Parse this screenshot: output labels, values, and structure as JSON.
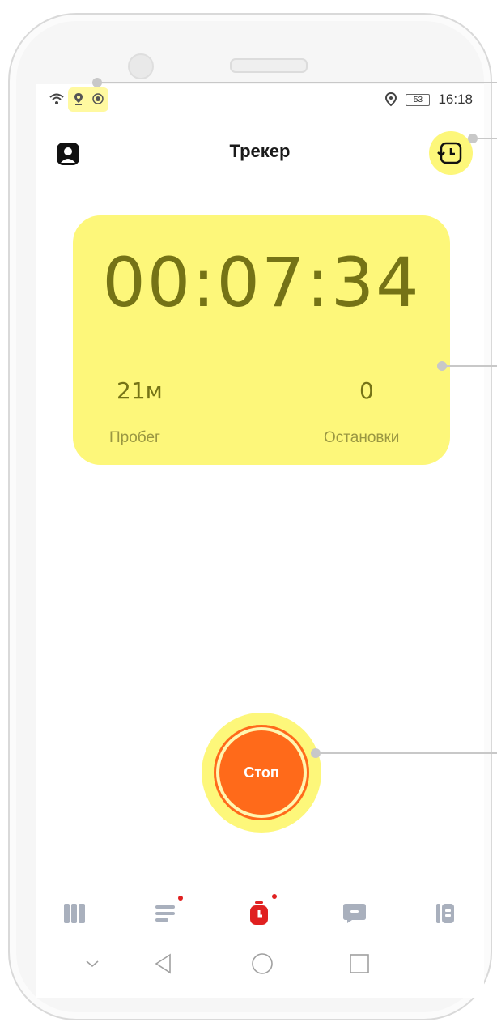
{
  "status_bar": {
    "time": "16:18",
    "battery": "53",
    "icons": [
      "wifi-icon",
      "location-pin-icon",
      "record-icon",
      "location-icon",
      "battery-icon"
    ]
  },
  "app_bar": {
    "title": "Трекер",
    "left_icon": "profile-icon",
    "right_icon": "history-icon"
  },
  "tracker": {
    "timer": "00:07:34",
    "mileage_value": "21м",
    "mileage_label": "Пробег",
    "stops_value": "0",
    "stops_label": "Остановки"
  },
  "stop_button": {
    "label": "Стоп"
  },
  "bottom_nav": {
    "items": [
      {
        "name": "map-icon",
        "active": false,
        "badge": false
      },
      {
        "name": "list-icon",
        "active": false,
        "badge": true
      },
      {
        "name": "stopwatch-icon",
        "active": true,
        "badge": true
      },
      {
        "name": "chat-icon",
        "active": false,
        "badge": false
      },
      {
        "name": "document-icon",
        "active": false,
        "badge": false
      }
    ]
  },
  "system_nav": [
    "chevron-down-icon",
    "back-icon",
    "home-icon",
    "recents-icon"
  ],
  "colors": {
    "highlight": "#fdf77a",
    "accent": "#ff6a1a",
    "text_olive": "#757316",
    "badge": "#e02020",
    "nav_icon": "#a9b0bd"
  }
}
